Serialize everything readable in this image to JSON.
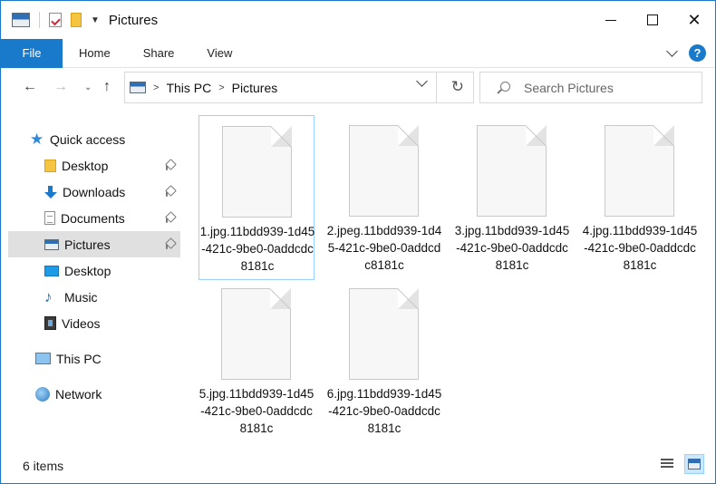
{
  "window": {
    "title": "Pictures",
    "controls": {
      "minimize": "—",
      "maximize": "☐",
      "close": "✕"
    }
  },
  "ribbon": {
    "file_tab": "File",
    "tabs": [
      "Home",
      "Share",
      "View"
    ],
    "help_label": "?"
  },
  "navigation": {
    "back_glyph": "←",
    "forward_glyph": "→",
    "recent_glyph": "⌄",
    "up_glyph": "↑",
    "breadcrumb": [
      "This PC",
      "Pictures"
    ],
    "separator_glyph": ">",
    "dropdown_glyph": "⌄",
    "refresh_glyph": "↻",
    "search_placeholder": "Search Pictures"
  },
  "sidebar": {
    "quick_access_label": "Quick access",
    "pinned": [
      {
        "label": "Desktop",
        "icon": "folder-icon"
      },
      {
        "label": "Downloads",
        "icon": "download-icon"
      },
      {
        "label": "Documents",
        "icon": "document-icon"
      },
      {
        "label": "Pictures",
        "icon": "pictures-icon",
        "selected": true
      }
    ],
    "libraries": [
      {
        "label": "Desktop",
        "icon": "desktop-icon"
      },
      {
        "label": "Music",
        "icon": "music-icon"
      },
      {
        "label": "Videos",
        "icon": "videos-icon"
      }
    ],
    "this_pc_label": "This PC",
    "network_label": "Network",
    "icon_glyphs": {
      "star": "★",
      "music": "♪"
    }
  },
  "files": [
    {
      "name": "1.jpg.11bdd939-1d45-421c-9be0-0addcdc8181c",
      "focused": true
    },
    {
      "name": "2.jpeg.11bdd939-1d45-421c-9be0-0addcdc8181c"
    },
    {
      "name": "3.jpg.11bdd939-1d45-421c-9be0-0addcdc8181c"
    },
    {
      "name": "4.jpg.11bdd939-1d45-421c-9be0-0addcdc8181c"
    },
    {
      "name": "5.jpg.11bdd939-1d45-421c-9be0-0addcdc8181c"
    },
    {
      "name": "6.jpg.11bdd939-1d45-421c-9be0-0addcdc8181c"
    }
  ],
  "status": {
    "item_count": "6 items"
  },
  "colors": {
    "accent": "#1979ca",
    "selection": "#e0e0e0",
    "focus_border": "#99d1ff"
  }
}
